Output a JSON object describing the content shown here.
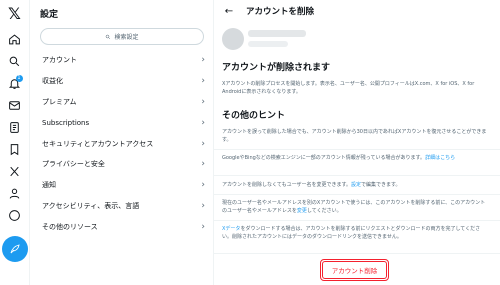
{
  "rail": {
    "logo": "𝕏",
    "icons": [
      "home-icon",
      "search-icon",
      "bell-icon",
      "mail-icon",
      "list-icon",
      "bookmark-icon",
      "x-premium-icon",
      "person-icon",
      "more-icon",
      "compose-icon"
    ],
    "notification_badge": "1",
    "accent": "#1d9bf0"
  },
  "settings": {
    "title": "設定",
    "search_placeholder": "検索設定",
    "items": [
      {
        "label": "アカウント"
      },
      {
        "label": "収益化"
      },
      {
        "label": "プレミアム"
      },
      {
        "label": "Subscriptions"
      },
      {
        "label": "セキュリティとアカウントアクセス"
      },
      {
        "label": "プライバシーと安全"
      },
      {
        "label": "通知"
      },
      {
        "label": "アクセシビリティ、表示、言語"
      },
      {
        "label": "その他のリソース"
      }
    ]
  },
  "panel": {
    "title": "アカウントを削除",
    "heading": "アカウントが削除されます",
    "description": "Xアカウントの削除プロセスを開始します。表示名、ユーザー名、公開プロフィールはX.com、X for iOS、X for Androidに表示されなくなります。",
    "hints_heading": "その他のヒント",
    "hints": [
      {
        "text": "アカウントを誤って削除した場合でも、アカウント削除から30日以内であればXアカウントを復元させることができます。",
        "link": ""
      },
      {
        "text": "GoogleやBingなどの検索エンジンに一部のアカウント情報が残っている場合があります。",
        "link": "詳細はこちら"
      },
      {
        "text": "アカウントを削除しなくてもユーザー名を変更できます。",
        "link": "設定",
        "suffix": "で編集できます。"
      },
      {
        "text": "現在のユーザー名やメールアドレスを別のXアカウントで使うには、このアカウントを削除する前に、このアカウントのユーザー名やメールアドレスを",
        "link": "変更",
        "suffix": "してください。"
      },
      {
        "text": "",
        "link": "Xデータ",
        "suffix": "をダウンロードする場合は、アカウントを削除する前にリクエストとダウンロードの両方を完了してください。削除されたアカウントにはデータのダウンロードリンクを送信できません。"
      }
    ],
    "delete_button": "アカウント削除",
    "danger_color": "#f4212e"
  }
}
